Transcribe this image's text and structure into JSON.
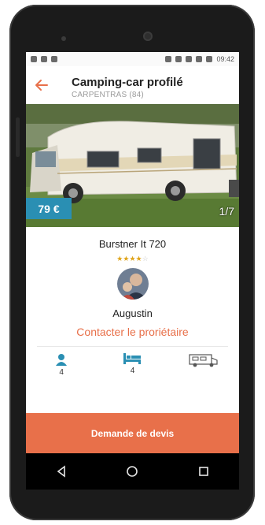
{
  "status": {
    "time": "09:42"
  },
  "header": {
    "title": "Camping-car profilé",
    "subtitle": "CARPENTRAS (84)"
  },
  "listing": {
    "price": "79 €",
    "photo_counter": "1/7",
    "model": "Burstner It 720",
    "rating": 4,
    "rating_max": 5
  },
  "owner": {
    "name": "Augustin",
    "contact_label": "Contacter le proriétaire"
  },
  "features": [
    {
      "icon": "person-icon",
      "value": "4"
    },
    {
      "icon": "bed-icon",
      "value": "4"
    },
    {
      "icon": "camper-van-icon",
      "value": ""
    }
  ],
  "cta": {
    "label": "Demande de devis"
  },
  "colors": {
    "accent": "#e8704a",
    "badge": "#2a8fb3",
    "icon_blue": "#2a8fb3"
  }
}
